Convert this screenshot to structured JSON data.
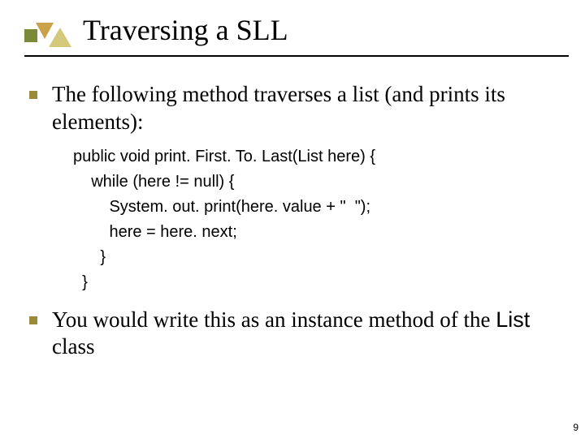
{
  "title": "Traversing a SLL",
  "bullets": [
    {
      "text": "The following method traverses a list (and prints its elements):"
    },
    {
      "text_prefix": "You would write this as an instance method of the ",
      "code_word": "List",
      "text_suffix": " class"
    }
  ],
  "code_lines": [
    "public void print. First. To. Last(List here) {",
    "    while (here != null) {",
    "        System. out. print(here. value + \"  \");",
    "        here = here. next;",
    "      }",
    "  }"
  ],
  "page_number": "9",
  "deco_colors": {
    "square": "#7a8a39",
    "tri1": "#c9a24a",
    "tri2": "#d4c97a"
  }
}
